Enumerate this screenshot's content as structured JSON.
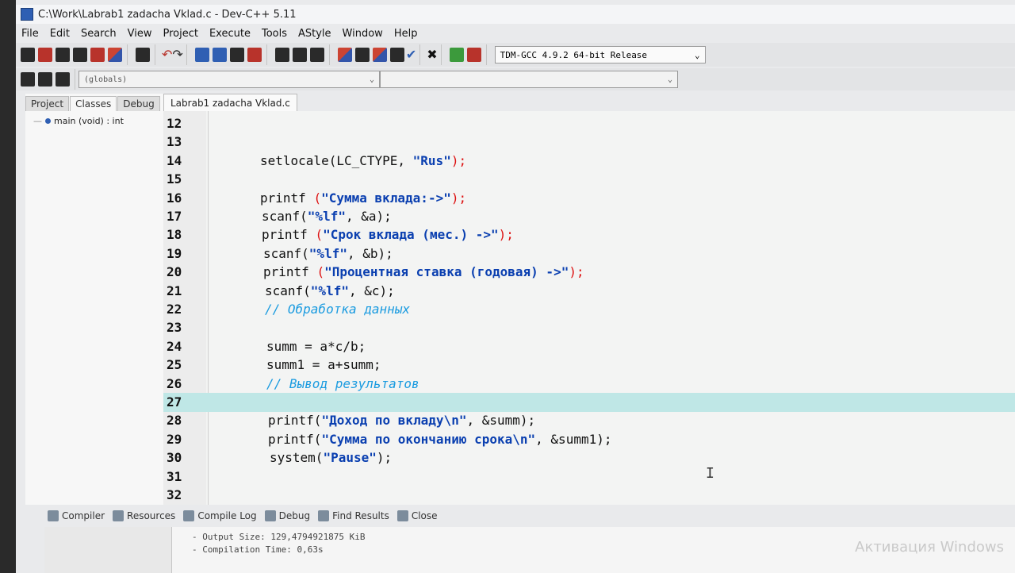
{
  "window": {
    "title": "C:\\Work\\Labrab1 zadacha Vklad.c - Dev-C++ 5.11"
  },
  "menu": [
    "File",
    "Edit",
    "Search",
    "View",
    "Project",
    "Execute",
    "Tools",
    "AStyle",
    "Window",
    "Help"
  ],
  "toolbar": {
    "compiler": "TDM-GCC 4.9.2 64-bit Release",
    "scope": "(globals)",
    "member": ""
  },
  "left_panel": {
    "tabs": [
      "Project",
      "Classes",
      "Debug"
    ],
    "active_tab": "Classes",
    "tree_item": "main (void) : int"
  },
  "editor": {
    "file_tab": "Labrab1 zadacha Vklad.c",
    "highlighted_line": 27,
    "lines": [
      {
        "n": "12",
        "code": []
      },
      {
        "n": "13",
        "code": []
      },
      {
        "n": "14",
        "code": [
          {
            "t": "setlocale(LC_CTYPE, "
          },
          {
            "t": "\"Rus\"",
            "c": "str"
          },
          {
            "t": ");",
            "c": "op"
          }
        ]
      },
      {
        "n": "15",
        "code": []
      },
      {
        "n": "16",
        "code": [
          {
            "t": "printf "
          },
          {
            "t": "(",
            "c": "op"
          },
          {
            "t": "\"Сумма вклада:->\"",
            "c": "str"
          },
          {
            "t": ");",
            "c": "op"
          }
        ]
      },
      {
        "n": "17",
        "code": [
          {
            "t": "scanf("
          },
          {
            "t": "\"%lf\"",
            "c": "str"
          },
          {
            "t": ", &a);"
          }
        ]
      },
      {
        "n": "18",
        "code": [
          {
            "t": "printf "
          },
          {
            "t": "(",
            "c": "op"
          },
          {
            "t": "\"Срок вклада (мес.) ->\"",
            "c": "str"
          },
          {
            "t": ");",
            "c": "op"
          }
        ]
      },
      {
        "n": "19",
        "code": [
          {
            "t": "scanf("
          },
          {
            "t": "\"%lf\"",
            "c": "str"
          },
          {
            "t": ", &b);"
          }
        ]
      },
      {
        "n": "20",
        "code": [
          {
            "t": "printf "
          },
          {
            "t": "(",
            "c": "op"
          },
          {
            "t": "\"Процентная ставка (годовая) ->\"",
            "c": "str"
          },
          {
            "t": ");",
            "c": "op"
          }
        ]
      },
      {
        "n": "21",
        "code": [
          {
            "t": "scanf("
          },
          {
            "t": "\"%lf\"",
            "c": "str"
          },
          {
            "t": ", &c);"
          }
        ]
      },
      {
        "n": "22",
        "code": [
          {
            "t": "// Обработка данных",
            "c": "cmt"
          }
        ]
      },
      {
        "n": "23",
        "code": []
      },
      {
        "n": "24",
        "code": [
          {
            "t": "summ = a*c/b;"
          }
        ]
      },
      {
        "n": "25",
        "code": [
          {
            "t": "summ1 = a+summ;"
          }
        ]
      },
      {
        "n": "26",
        "code": [
          {
            "t": "// Вывод результатов",
            "c": "cmt"
          }
        ]
      },
      {
        "n": "27",
        "code": []
      },
      {
        "n": "28",
        "code": [
          {
            "t": "printf("
          },
          {
            "t": "\"Доход по вкладу\\n\"",
            "c": "str"
          },
          {
            "t": ", &summ);"
          }
        ]
      },
      {
        "n": "29",
        "code": [
          {
            "t": "printf("
          },
          {
            "t": "\"Сумма по окончанию срока\\n\"",
            "c": "str"
          },
          {
            "t": ", &summ1);"
          }
        ]
      },
      {
        "n": "30",
        "code": [
          {
            "t": "system("
          },
          {
            "t": "\"Pause\"",
            "c": "str"
          },
          {
            "t": ");"
          }
        ]
      },
      {
        "n": "31",
        "code": []
      },
      {
        "n": "32",
        "code": []
      }
    ]
  },
  "bottom": {
    "tabs": [
      "Compiler",
      "Resources",
      "Compile Log",
      "Debug",
      "Find Results",
      "Close"
    ],
    "output": [
      "- Output Size: 129,4794921875 KiB",
      "- Compilation Time: 0,63s"
    ],
    "watermark": "Активация Windows"
  }
}
